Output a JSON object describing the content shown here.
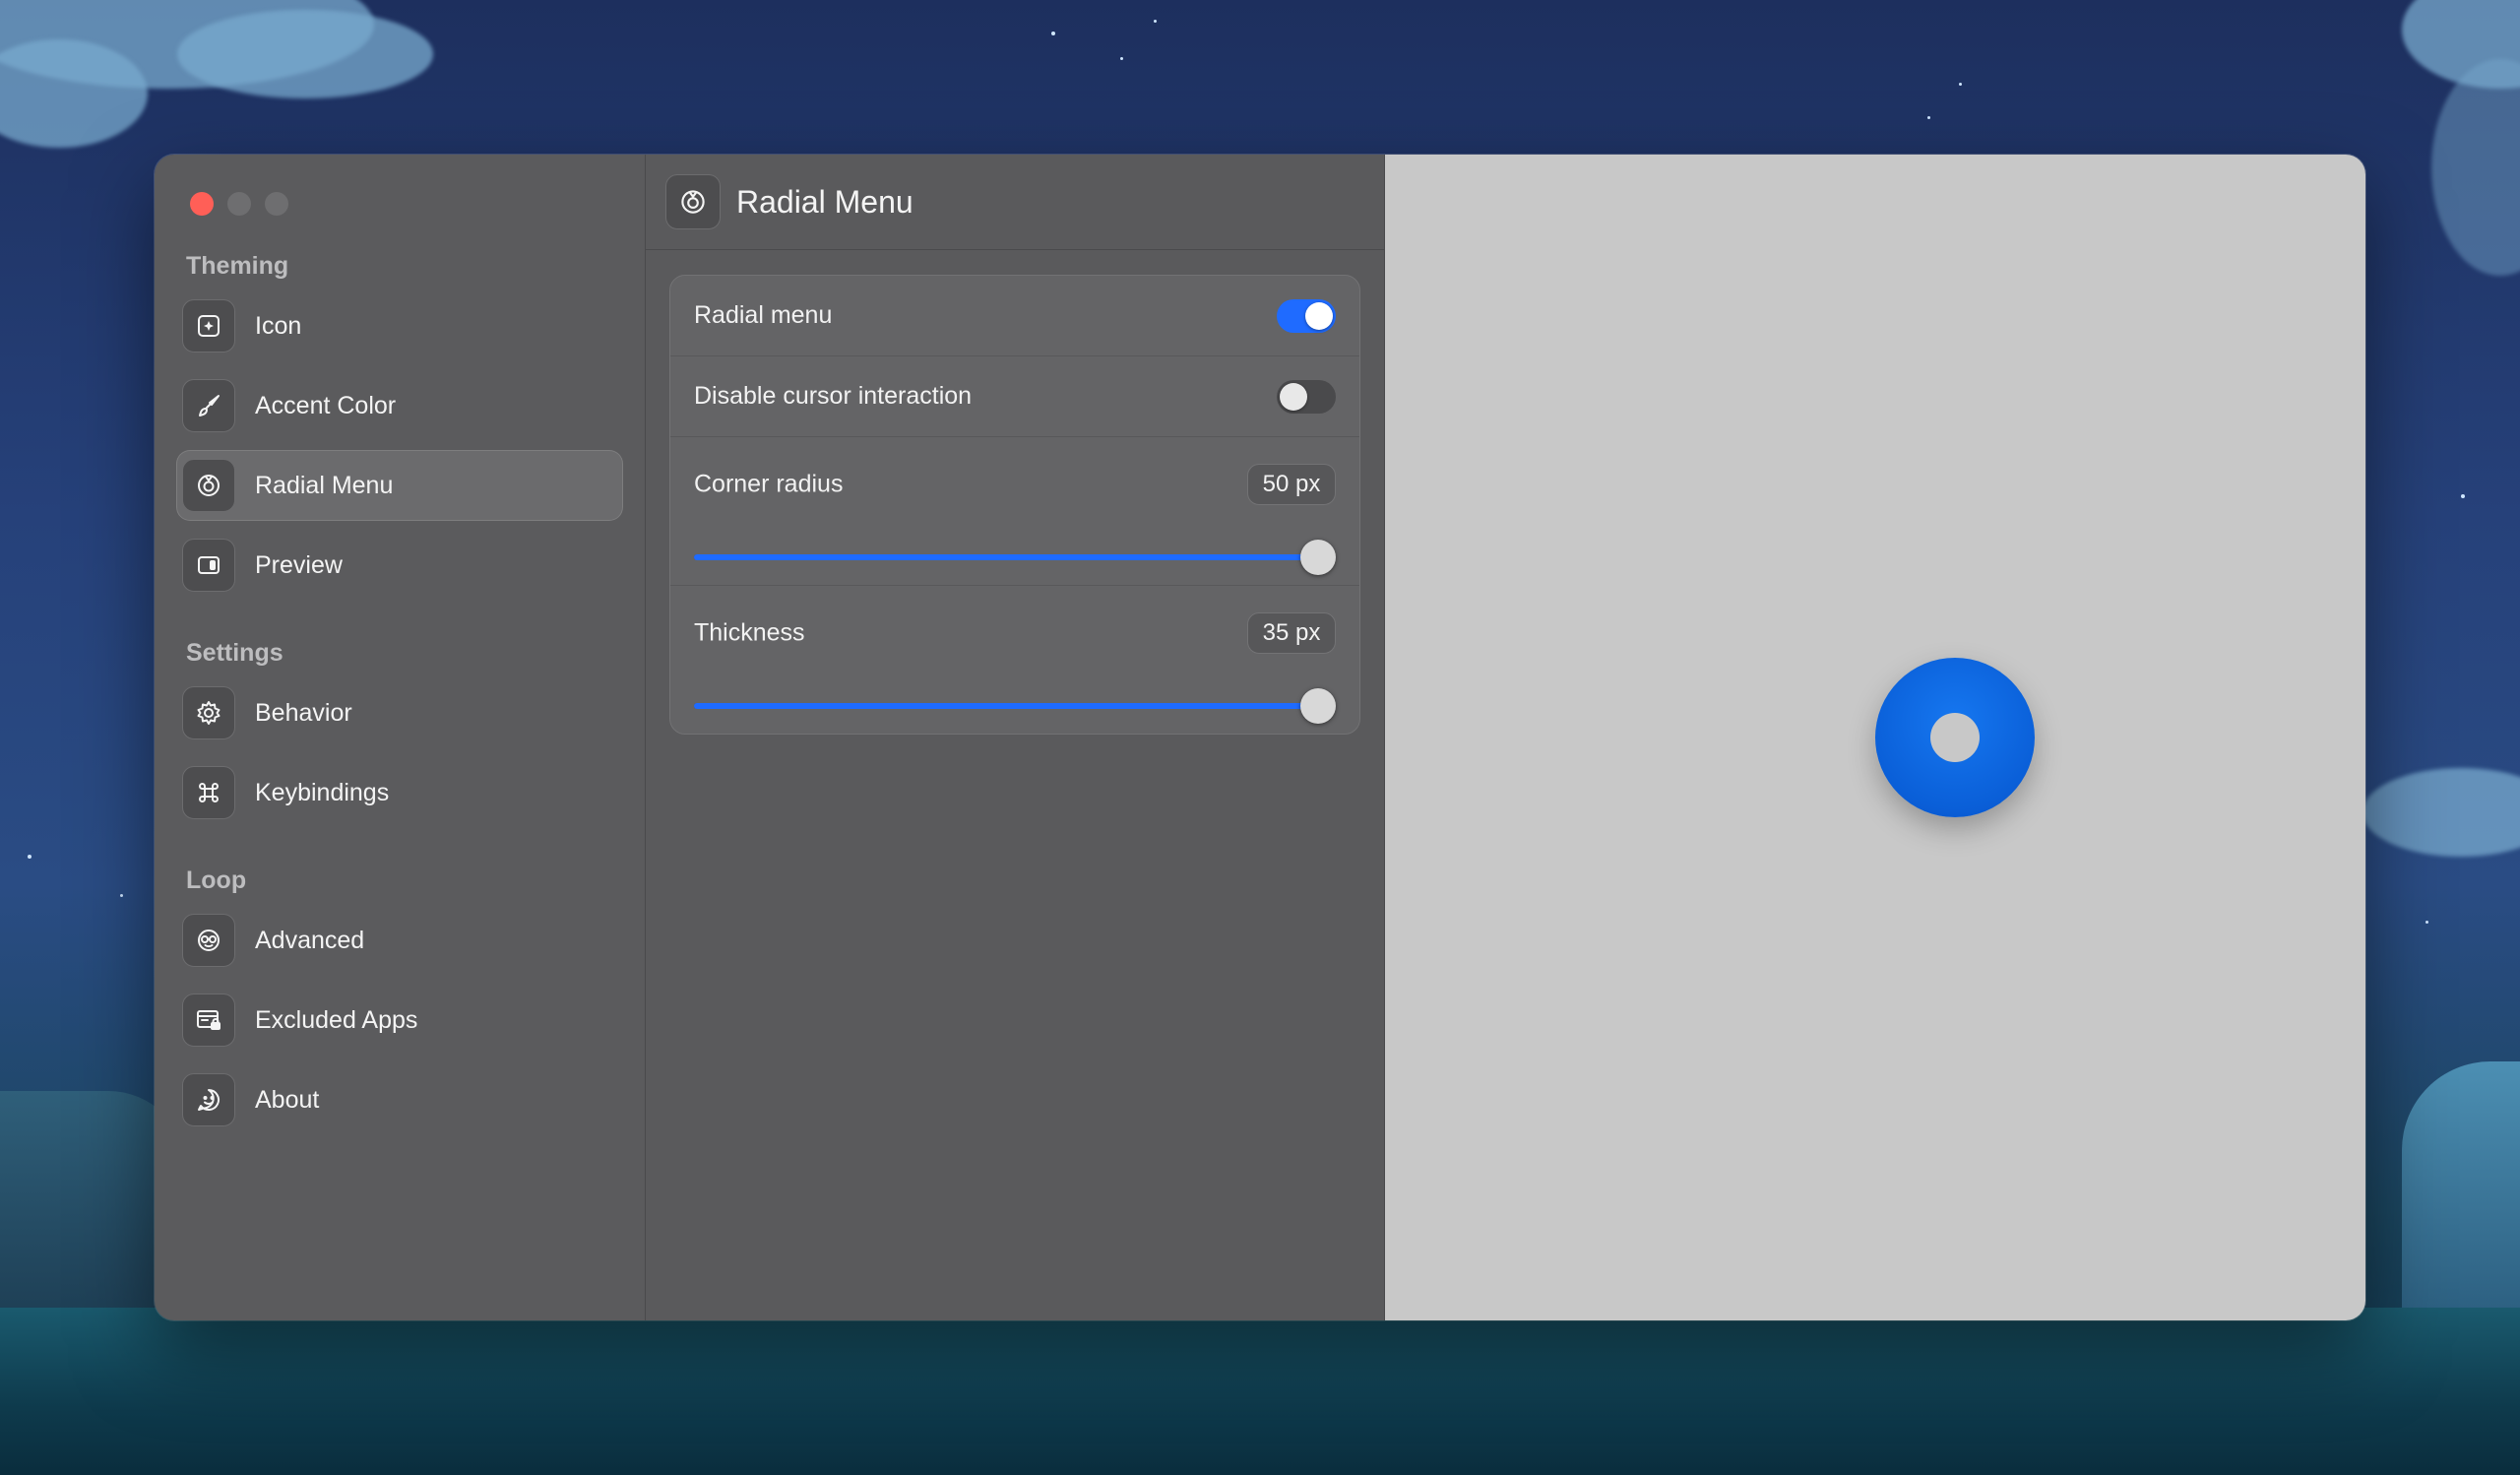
{
  "sidebar": {
    "sections": [
      {
        "title": "Theming",
        "items": [
          {
            "label": "Icon",
            "icon": "app-icon-icon"
          },
          {
            "label": "Accent Color",
            "icon": "paintbrush-icon"
          },
          {
            "label": "Radial Menu",
            "icon": "radial-menu-icon",
            "selected": true
          },
          {
            "label": "Preview",
            "icon": "sidebar-preview-icon"
          }
        ]
      },
      {
        "title": "Settings",
        "items": [
          {
            "label": "Behavior",
            "icon": "gear-icon"
          },
          {
            "label": "Keybindings",
            "icon": "command-icon"
          }
        ]
      },
      {
        "title": "Loop",
        "items": [
          {
            "label": "Advanced",
            "icon": "glasses-face-icon"
          },
          {
            "label": "Excluded Apps",
            "icon": "window-lock-icon"
          },
          {
            "label": "About",
            "icon": "smiley-bubble-icon"
          }
        ]
      }
    ]
  },
  "main": {
    "title": "Radial Menu",
    "settings": {
      "radial_menu": {
        "label": "Radial menu",
        "enabled": true
      },
      "disable_cursor": {
        "label": "Disable cursor interaction",
        "enabled": false
      },
      "corner_radius": {
        "label": "Corner radius",
        "value_text": "50 px",
        "fraction": 1.0
      },
      "thickness": {
        "label": "Thickness",
        "value_text": "35 px",
        "fraction": 1.0
      }
    }
  },
  "colors": {
    "accent": "#1f6bff",
    "radial_ring": "#0a60d8",
    "close_button": "#ff5f57"
  }
}
